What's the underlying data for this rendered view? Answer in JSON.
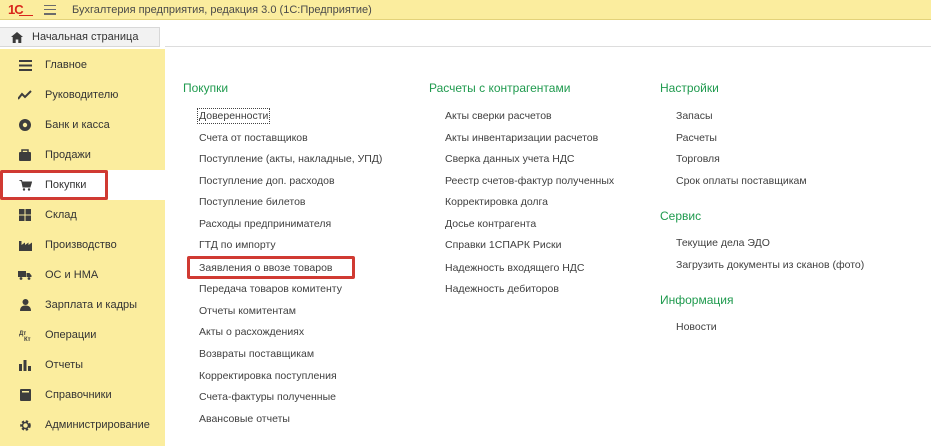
{
  "app": {
    "title": "Бухгалтерия предприятия, редакция 3.0  (1С:Предприятие)",
    "logo_text": "1С"
  },
  "home_tab": {
    "label": "Начальная страница",
    "icon": "home-icon"
  },
  "sidebar": {
    "items": [
      {
        "label": "Главное",
        "icon": "list-icon"
      },
      {
        "label": "Руководителю",
        "icon": "trend-icon"
      },
      {
        "label": "Банк и касса",
        "icon": "bank-icon"
      },
      {
        "label": "Продажи",
        "icon": "sales-icon"
      },
      {
        "label": "Покупки",
        "icon": "cart-icon",
        "active": true
      },
      {
        "label": "Склад",
        "icon": "warehouse-icon"
      },
      {
        "label": "Производство",
        "icon": "factory-icon"
      },
      {
        "label": "ОС и НМА",
        "icon": "truck-icon"
      },
      {
        "label": "Зарплата и кадры",
        "icon": "person-icon"
      },
      {
        "label": "Операции",
        "icon": "operations-icon"
      },
      {
        "label": "Отчеты",
        "icon": "bar-chart-icon"
      },
      {
        "label": "Справочники",
        "icon": "book-icon"
      },
      {
        "label": "Администрирование",
        "icon": "gear-icon"
      }
    ]
  },
  "columns": {
    "purchases": {
      "title": "Покупки",
      "links": [
        "Доверенности",
        "Счета от поставщиков",
        "Поступление (акты, накладные, УПД)",
        "Поступление доп. расходов",
        "Поступление билетов",
        "Расходы предпринимателя",
        "ГТД по импорту",
        "Заявления о ввозе товаров",
        "Передача товаров комитенту",
        "Отчеты комитентам",
        "Акты о расхождениях",
        "Возвраты поставщикам",
        "Корректировка поступления",
        "Счета-фактуры полученные",
        "Авансовые отчеты"
      ]
    },
    "settlements": {
      "title": "Расчеты с контрагентами",
      "links": [
        "Акты сверки расчетов",
        "Акты инвентаризации расчетов",
        "Сверка данных учета НДС",
        "Реестр счетов-фактур полученных",
        "Корректировка долга",
        "Досье контрагента",
        "Справки 1СПАРК Риски",
        "Надежность входящего НДС",
        "Надежность дебиторов"
      ]
    },
    "settings": {
      "title": "Настройки",
      "links": [
        "Запасы",
        "Расчеты",
        "Торговля",
        "Срок оплаты поставщикам"
      ]
    },
    "service": {
      "title": "Сервис",
      "links": [
        "Текущие дела ЭДО",
        "Загрузить документы из сканов (фото)"
      ]
    },
    "info": {
      "title": "Информация",
      "links": [
        "Новости"
      ]
    }
  },
  "colors": {
    "sidebar_bg": "#fbed9e",
    "section_title": "#1f9a4e",
    "highlight_frame": "#d03a32"
  }
}
